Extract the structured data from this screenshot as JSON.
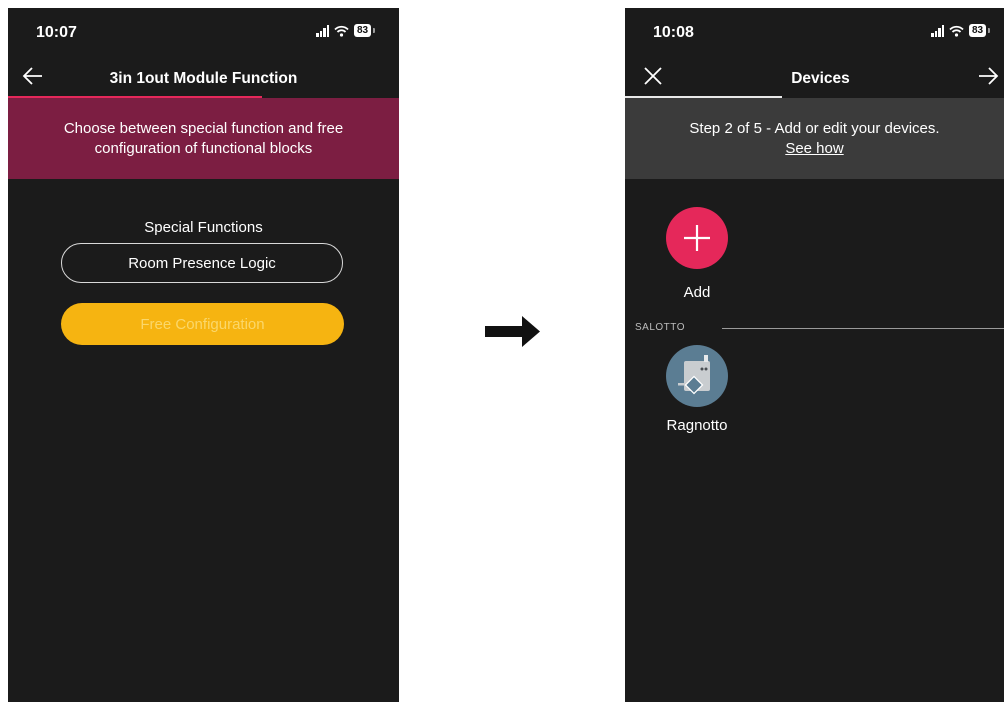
{
  "left_screen": {
    "status": {
      "time": "10:07",
      "battery": "83"
    },
    "nav": {
      "title": "3in 1out Module Function"
    },
    "banner": {
      "line1": "Choose between special function and free",
      "line2": "configuration of functional blocks"
    },
    "section_title": "Special Functions",
    "room_presence_button": "Room Presence Logic",
    "free_config_button": "Free Configuration"
  },
  "right_screen": {
    "status": {
      "time": "10:08",
      "battery": "83"
    },
    "nav": {
      "title": "Devices"
    },
    "banner": {
      "text": "Step 2 of 5 - Add or edit your devices.",
      "link": "See how"
    },
    "add_label": "Add",
    "group": {
      "label": "SALOTTO"
    },
    "device": {
      "label": "Ragnotto"
    }
  },
  "colors": {
    "phone_bg": "#1b1b1b",
    "accent_red": "#e5285a",
    "banner_maroon": "#7c1e42",
    "yellow": "#f6b411",
    "device_icon_bg": "#5b7d93"
  },
  "icons": [
    "back-arrow-icon",
    "close-icon",
    "forward-arrow-icon",
    "plus-icon",
    "device-icon",
    "signal-icon",
    "wifi-icon",
    "battery-icon",
    "transition-arrow-icon"
  ]
}
